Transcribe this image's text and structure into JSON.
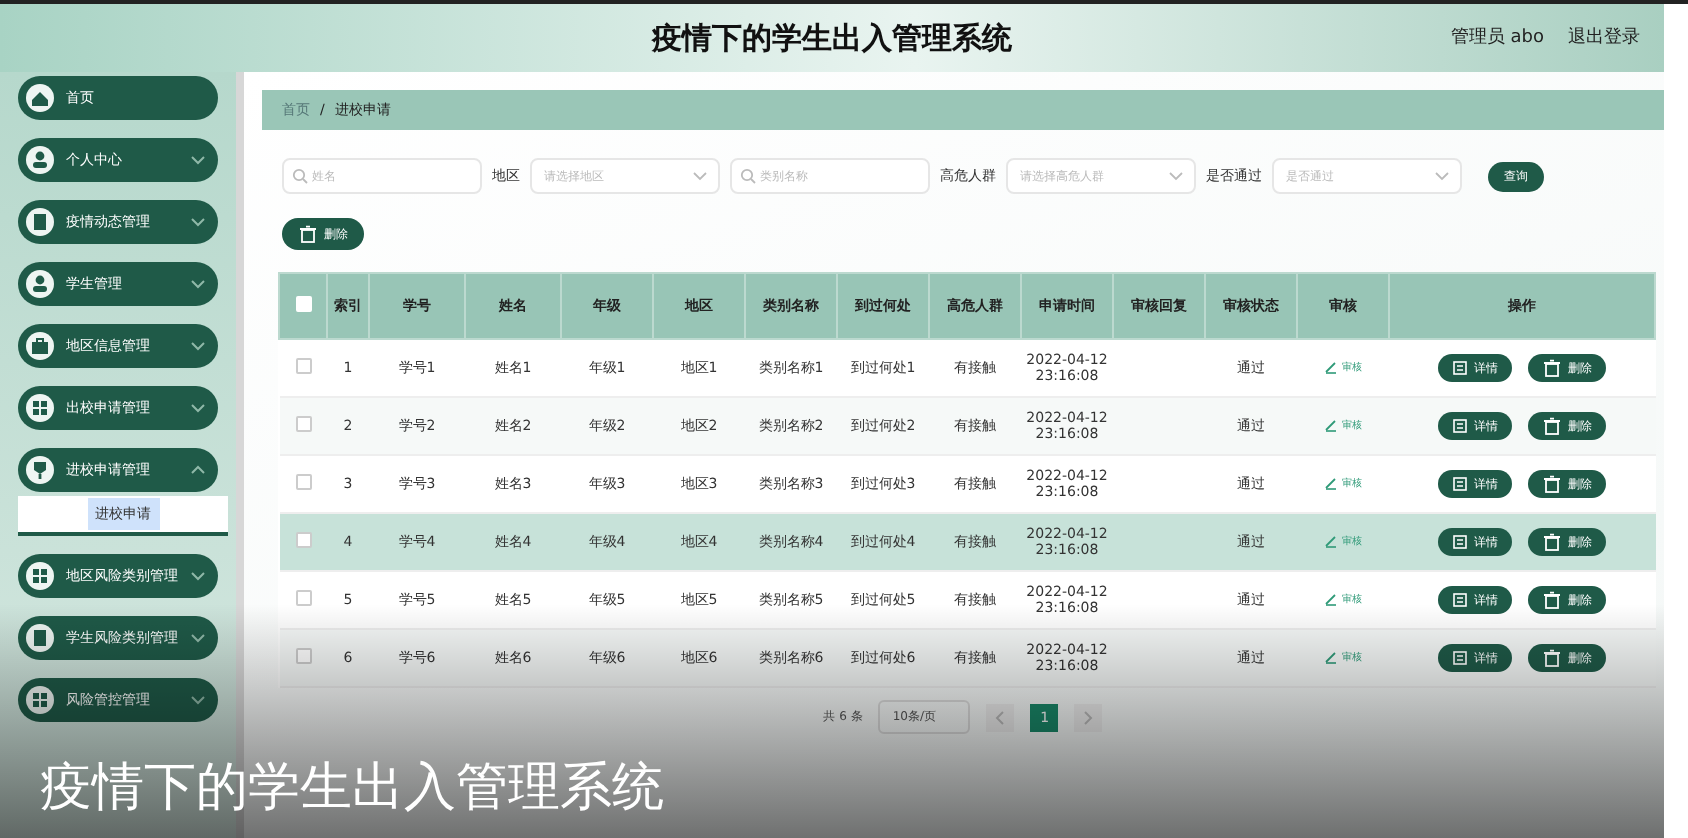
{
  "header": {
    "title": "疫情下的学生出入管理系统",
    "user": "管理员 abo",
    "logout": "退出登录"
  },
  "sidebar": {
    "items": [
      {
        "label": "首页",
        "expandable": false
      },
      {
        "label": "个人中心",
        "expandable": true,
        "expanded": false
      },
      {
        "label": "疫情动态管理",
        "expandable": true,
        "expanded": false
      },
      {
        "label": "学生管理",
        "expandable": true,
        "expanded": false
      },
      {
        "label": "地区信息管理",
        "expandable": true,
        "expanded": false
      },
      {
        "label": "出校申请管理",
        "expandable": true,
        "expanded": false
      },
      {
        "label": "进校申请管理",
        "expandable": true,
        "expanded": true,
        "children": [
          {
            "label": "进校申请",
            "selected": true
          }
        ]
      },
      {
        "label": "地区风险类别管理",
        "expandable": true,
        "expanded": false
      },
      {
        "label": "学生风险类别管理",
        "expandable": true,
        "expanded": false
      },
      {
        "label": "风险管控管理",
        "expandable": true,
        "expanded": false
      }
    ]
  },
  "breadcrumb": {
    "items": [
      "首页",
      "进校申请"
    ],
    "separator": "/"
  },
  "filters": [
    {
      "kind": "search",
      "placeholder": "姓名"
    },
    {
      "kind": "select",
      "label": "地区",
      "placeholder": "请选择地区"
    },
    {
      "kind": "search",
      "placeholder": "类别名称"
    },
    {
      "kind": "select",
      "label": "高危人群",
      "placeholder": "请选择高危人群"
    },
    {
      "kind": "select",
      "label": "是否通过",
      "placeholder": "是否通过"
    }
  ],
  "search_button": "查询",
  "delete_button": "删除",
  "table": {
    "select_all_checked": false,
    "columns": [
      "索引",
      "学号",
      "姓名",
      "年级",
      "地区",
      "类别名称",
      "到过何处",
      "高危人群",
      "申请时间",
      "审核回复",
      "审核状态",
      "审核",
      "操作"
    ],
    "rows": [
      {
        "checked": false,
        "highlighted": false,
        "cells": [
          "1",
          "学号1",
          "姓名1",
          "年级1",
          "地区1",
          "类别名称1",
          "到过何处1",
          "有接触",
          "2022-04-12 23:16:08",
          "",
          "通过"
        ],
        "review": "审核",
        "detail": "详情",
        "delete": "删除"
      },
      {
        "checked": false,
        "highlighted": false,
        "cells": [
          "2",
          "学号2",
          "姓名2",
          "年级2",
          "地区2",
          "类别名称2",
          "到过何处2",
          "有接触",
          "2022-04-12 23:16:08",
          "",
          "通过"
        ],
        "review": "审核",
        "detail": "详情",
        "delete": "删除"
      },
      {
        "checked": false,
        "highlighted": false,
        "cells": [
          "3",
          "学号3",
          "姓名3",
          "年级3",
          "地区3",
          "类别名称3",
          "到过何处3",
          "有接触",
          "2022-04-12 23:16:08",
          "",
          "通过"
        ],
        "review": "审核",
        "detail": "详情",
        "delete": "删除"
      },
      {
        "checked": false,
        "highlighted": true,
        "cells": [
          "4",
          "学号4",
          "姓名4",
          "年级4",
          "地区4",
          "类别名称4",
          "到过何处4",
          "有接触",
          "2022-04-12 23:16:08",
          "",
          "通过"
        ],
        "review": "审核",
        "detail": "详情",
        "delete": "删除"
      },
      {
        "checked": false,
        "highlighted": false,
        "cells": [
          "5",
          "学号5",
          "姓名5",
          "年级5",
          "地区5",
          "类别名称5",
          "到过何处5",
          "有接触",
          "2022-04-12 23:16:08",
          "",
          "通过"
        ],
        "review": "审核",
        "detail": "详情",
        "delete": "删除"
      },
      {
        "checked": false,
        "highlighted": false,
        "cells": [
          "6",
          "学号6",
          "姓名6",
          "年级6",
          "地区6",
          "类别名称6",
          "到过何处6",
          "有接触",
          "2022-04-12 23:16:08",
          "",
          "通过"
        ],
        "review": "审核",
        "detail": "详情",
        "delete": "删除"
      }
    ]
  },
  "pagination": {
    "total": "共 6 条",
    "page_size": "10条/页",
    "pages": [
      {
        "label": "1",
        "selected": true
      }
    ]
  },
  "caption": "疫情下的学生出入管理系统"
}
